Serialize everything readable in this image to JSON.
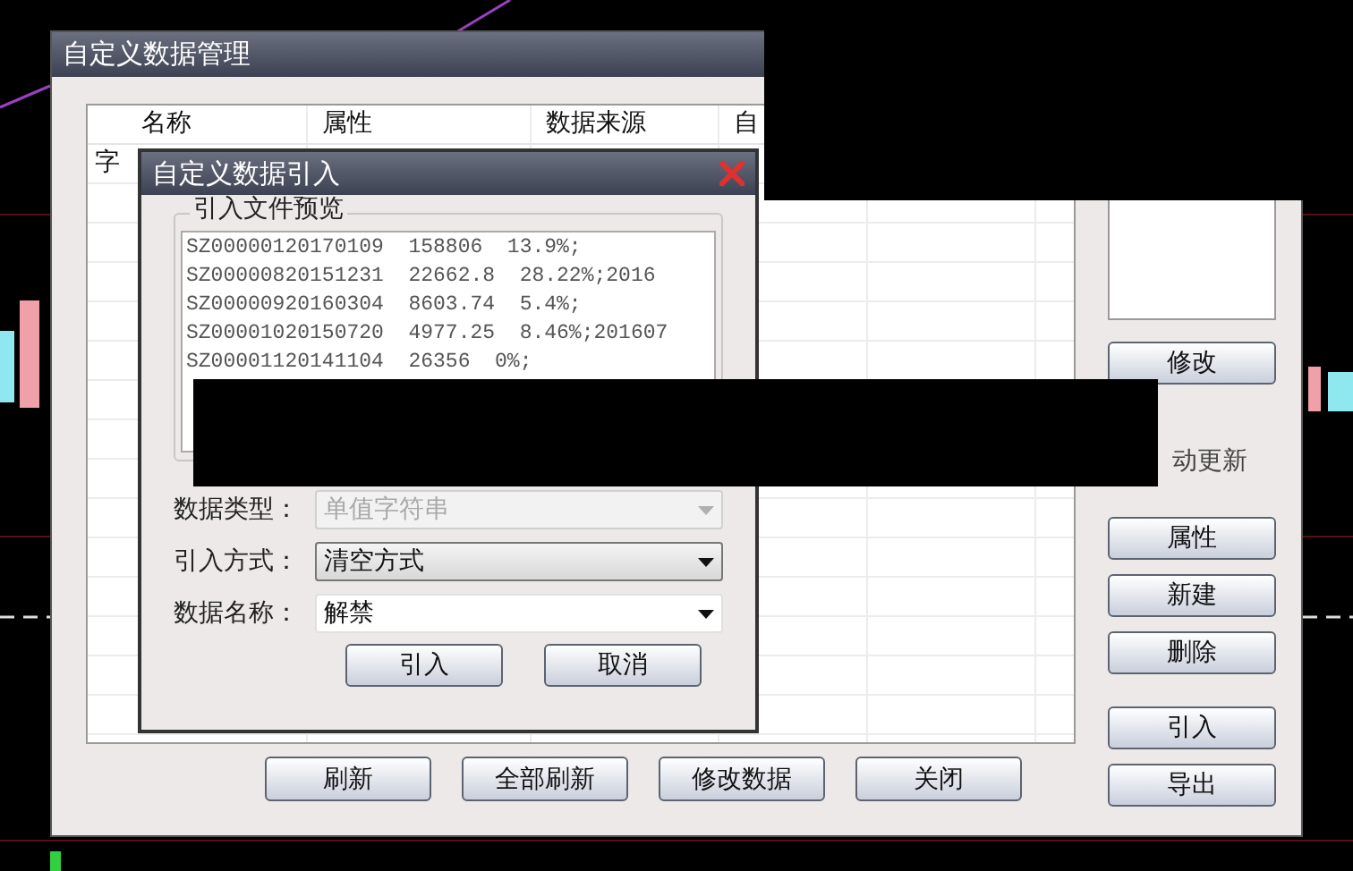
{
  "main_window": {
    "title": "自定义数据管理",
    "table": {
      "columns": [
        "名称",
        "属性",
        "数据来源",
        "自"
      ],
      "rows": [
        {
          "cells": [
            "字"
          ]
        }
      ]
    },
    "side_panel": {
      "edit_button": "修改",
      "auto_update_label": "动更新",
      "buttons": [
        "属性",
        "新建",
        "删除",
        "引入",
        "导出"
      ]
    },
    "bottom_buttons": [
      "刷新",
      "全部刷新",
      "修改数据",
      "关闭"
    ]
  },
  "import_dialog": {
    "title": "自定义数据引入",
    "preview_label": "引入文件预览",
    "preview_lines": [
      "SZ00000120170109  158806  13.9%;",
      "SZ00000820151231  22662.8  28.22%;2016",
      "SZ00000920160304  8603.74  5.4%;",
      "SZ00001020150720  4977.25  8.46%;201607",
      "SZ00001120141104  26356  0%;"
    ],
    "fields": [
      {
        "label": "数据类型：",
        "value": "单值字符串",
        "disabled": true,
        "kind": "dropdown"
      },
      {
        "label": "引入方式：",
        "value": "清空方式",
        "disabled": false,
        "kind": "dropdown"
      },
      {
        "label": "数据名称：",
        "value": "解禁",
        "disabled": false,
        "kind": "editable"
      }
    ],
    "buttons": [
      "引入",
      "取消"
    ]
  }
}
